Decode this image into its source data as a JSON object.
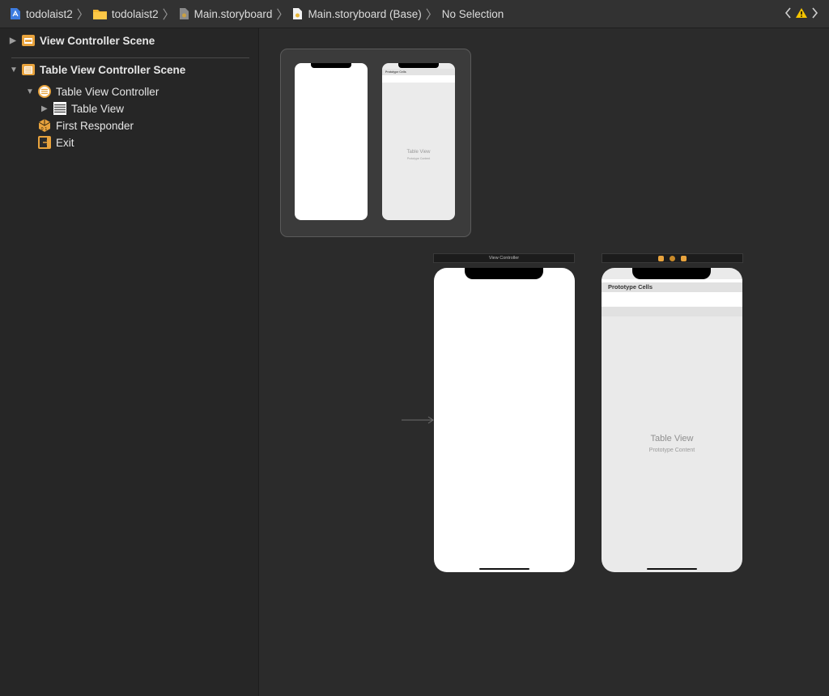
{
  "breadcrumb": {
    "items": [
      {
        "label": "todolaist2",
        "icon": "project-icon"
      },
      {
        "label": "todolaist2",
        "icon": "folder-icon"
      },
      {
        "label": "Main.storyboard",
        "icon": "storyboard-file-icon"
      },
      {
        "label": "Main.storyboard (Base)",
        "icon": "storyboard-base-icon"
      },
      {
        "label": "No Selection",
        "icon": ""
      }
    ],
    "separator": "〉"
  },
  "jumpbar_right": {
    "back_icon": "chevron-left-icon",
    "warning_icon": "warning-icon"
  },
  "outline": {
    "scenes": [
      {
        "label": "View Controller Scene",
        "expanded": false,
        "icon": "scene-icon"
      },
      {
        "label": "Table View Controller Scene",
        "expanded": true,
        "icon": "scene-icon"
      }
    ],
    "children": [
      {
        "label": "Table View Controller",
        "expanded": true,
        "icon": "table-view-controller-icon"
      },
      {
        "label": "Table View",
        "expanded": false,
        "icon": "table-view-icon"
      },
      {
        "label": "First Responder",
        "icon": "first-responder-icon"
      },
      {
        "label": "Exit",
        "icon": "exit-icon"
      }
    ]
  },
  "canvas": {
    "overview": {
      "table_prototype_header": "Prototype Cells",
      "table_label": "Table View",
      "table_sublabel": "Prototype Content"
    },
    "vc_scene_title": "View Controller",
    "tv_scene": {
      "prototype_header": "Prototype Cells",
      "table_label": "Table View",
      "table_sublabel": "Prototype Content"
    }
  },
  "colors": {
    "accent_orange": "#e8a33d",
    "warning_yellow": "#f5c400",
    "background": "#2b2b2b"
  }
}
